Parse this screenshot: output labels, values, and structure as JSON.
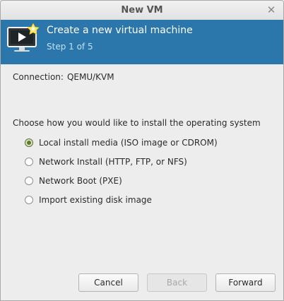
{
  "window": {
    "title": "New VM"
  },
  "banner": {
    "title": "Create a new virtual machine",
    "step": "Step 1 of 5",
    "icon": "monitor-with-star-icon"
  },
  "connection": {
    "label": "Connection:",
    "value": "QEMU/KVM"
  },
  "install": {
    "prompt": "Choose how you would like to install the operating system",
    "options": [
      {
        "label": "Local install media (ISO image or CDROM)",
        "selected": true
      },
      {
        "label": "Network Install (HTTP, FTP, or NFS)",
        "selected": false
      },
      {
        "label": "Network Boot (PXE)",
        "selected": false
      },
      {
        "label": "Import existing disk image",
        "selected": false
      }
    ]
  },
  "buttons": {
    "cancel": "Cancel",
    "back": "Back",
    "forward": "Forward",
    "back_disabled": true
  },
  "colors": {
    "banner_bg": "#2b77ab",
    "banner_step_text": "#bfe0f5",
    "radio_selected": "#5e7a2c",
    "window_bg": "#ededed"
  }
}
